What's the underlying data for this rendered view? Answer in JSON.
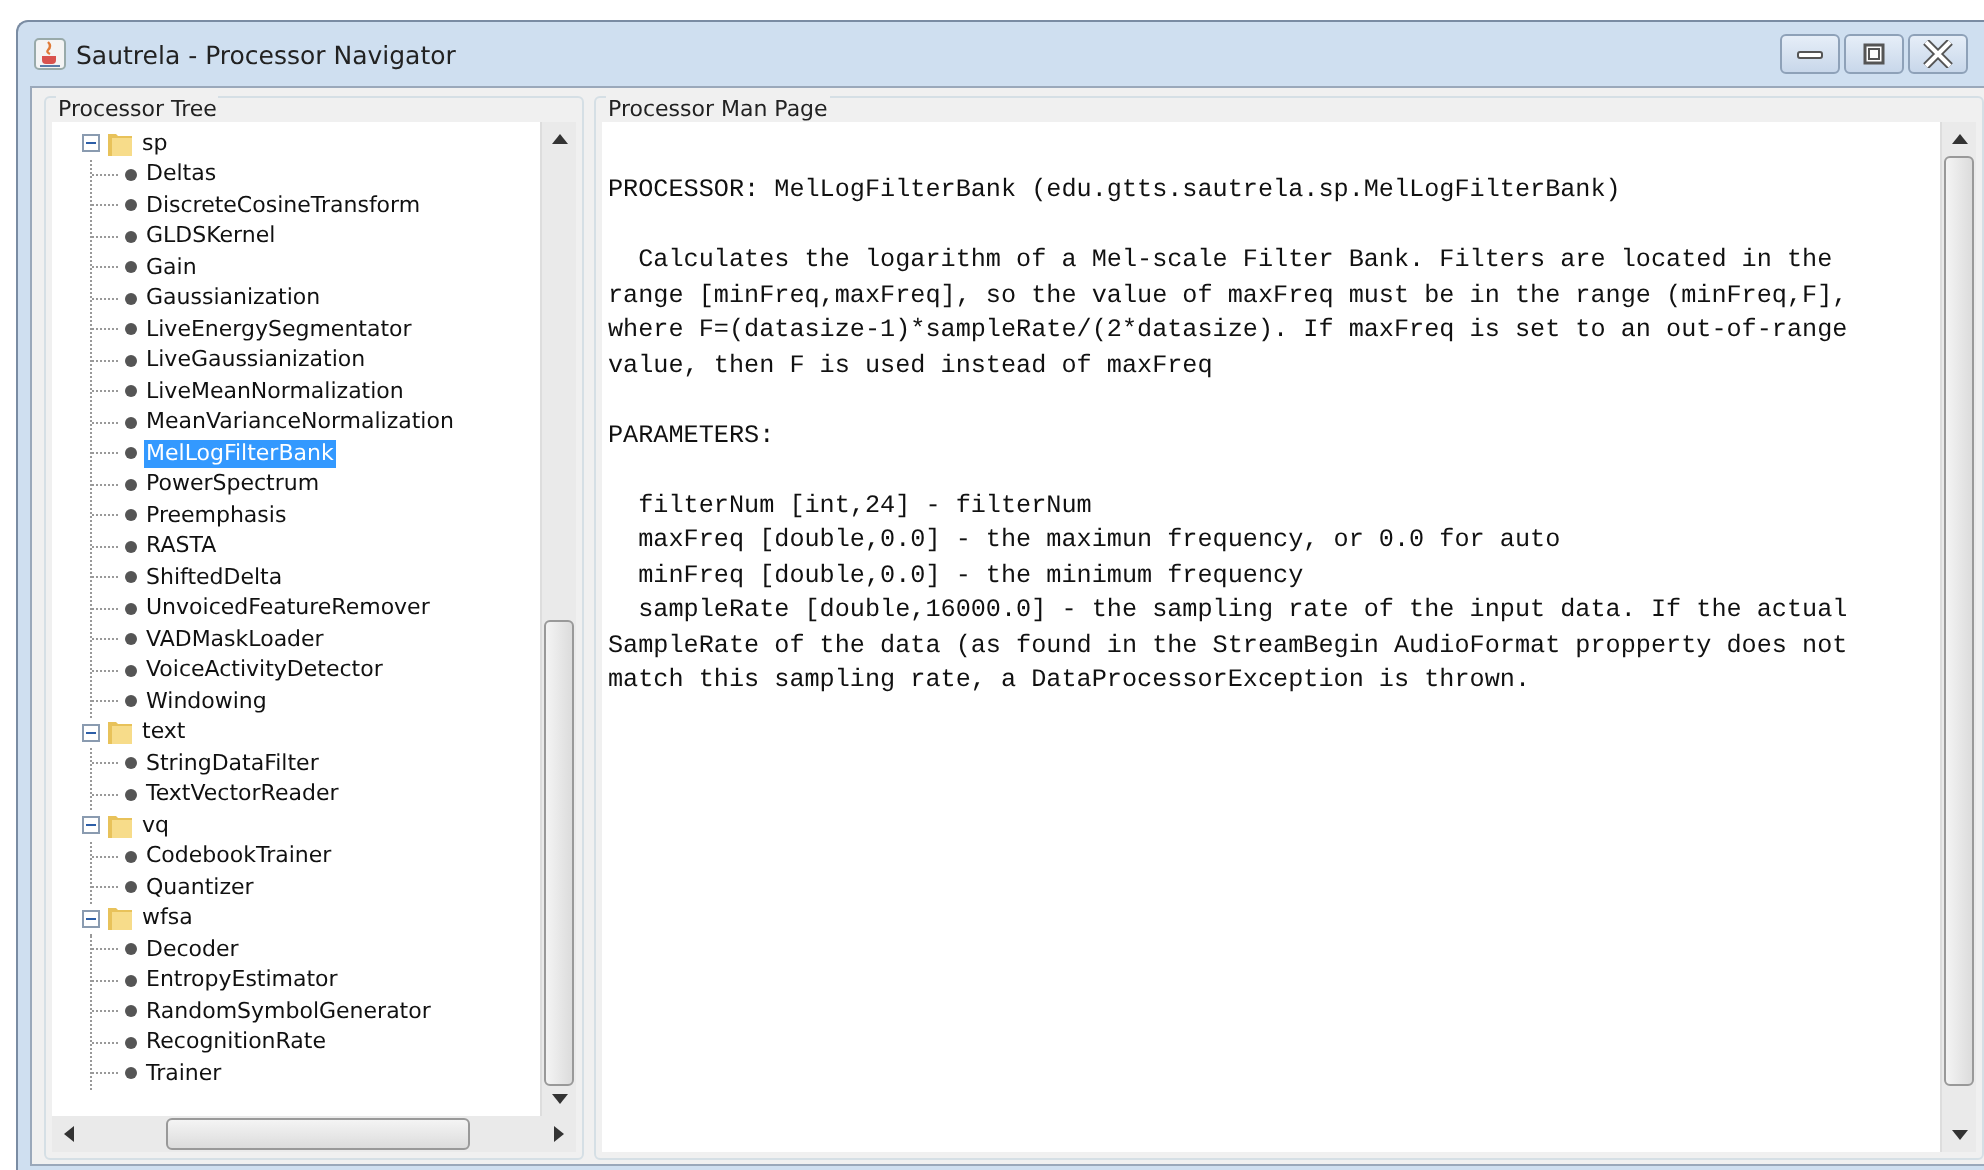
{
  "window": {
    "title": "Sautrela  -  Processor Navigator"
  },
  "tree_panel": {
    "title": "Processor Tree",
    "tree": [
      {
        "label": "sp",
        "expanded": true,
        "children": [
          {
            "label": "Deltas",
            "selected": false
          },
          {
            "label": "DiscreteCosineTransform",
            "selected": false
          },
          {
            "label": "GLDSKernel",
            "selected": false
          },
          {
            "label": "Gain",
            "selected": false
          },
          {
            "label": "Gaussianization",
            "selected": false
          },
          {
            "label": "LiveEnergySegmentator",
            "selected": false
          },
          {
            "label": "LiveGaussianization",
            "selected": false
          },
          {
            "label": "LiveMeanNormalization",
            "selected": false
          },
          {
            "label": "MeanVarianceNormalization",
            "selected": false
          },
          {
            "label": "MelLogFilterBank",
            "selected": true
          },
          {
            "label": "PowerSpectrum",
            "selected": false
          },
          {
            "label": "Preemphasis",
            "selected": false
          },
          {
            "label": "RASTA",
            "selected": false
          },
          {
            "label": "ShiftedDelta",
            "selected": false
          },
          {
            "label": "UnvoicedFeatureRemover",
            "selected": false
          },
          {
            "label": "VADMaskLoader",
            "selected": false
          },
          {
            "label": "VoiceActivityDetector",
            "selected": false
          },
          {
            "label": "Windowing",
            "selected": false
          }
        ]
      },
      {
        "label": "text",
        "expanded": true,
        "children": [
          {
            "label": "StringDataFilter",
            "selected": false
          },
          {
            "label": "TextVectorReader",
            "selected": false
          }
        ]
      },
      {
        "label": "vq",
        "expanded": true,
        "children": [
          {
            "label": "CodebookTrainer",
            "selected": false
          },
          {
            "label": "Quantizer",
            "selected": false
          }
        ]
      },
      {
        "label": "wfsa",
        "expanded": true,
        "children": [
          {
            "label": "Decoder",
            "selected": false
          },
          {
            "label": "EntropyEstimator",
            "selected": false
          },
          {
            "label": "RandomSymbolGenerator",
            "selected": false
          },
          {
            "label": "RecognitionRate",
            "selected": false
          },
          {
            "label": "Trainer",
            "selected": false
          }
        ]
      }
    ]
  },
  "man_page": {
    "title": "Processor Man Page",
    "paragraphs": [
      {
        "lines": [
          "PROCESSOR: MelLogFilterBank (edu.gtts.sautrela.sp.MelLogFilterBank)"
        ]
      },
      {
        "lines": [
          "  Calculates the logarithm of a Mel-scale Filter Bank. Filters are located in the",
          "range [minFreq,maxFreq], so the value of maxFreq must be in the range (minFreq,F],",
          "where F=(datasize-1)*sampleRate/(2*datasize). If maxFreq is set to an out-of-range",
          "value, then F is used instead of maxFreq"
        ]
      },
      {
        "lines": [
          "PARAMETERS:"
        ]
      },
      {
        "lines": [
          "  filterNum [int,24] - filterNum",
          "  maxFreq [double,0.0] - the maximun frequency, or 0.0 for auto",
          "  minFreq [double,0.0] - the minimum frequency",
          "  sampleRate [double,16000.0] - the sampling rate of the input data. If the actual",
          "SampleRate of the data (as found in the StreamBegin AudioFormat propperty does not",
          "match this sampling rate, a DataProcessorException is thrown."
        ]
      }
    ]
  }
}
